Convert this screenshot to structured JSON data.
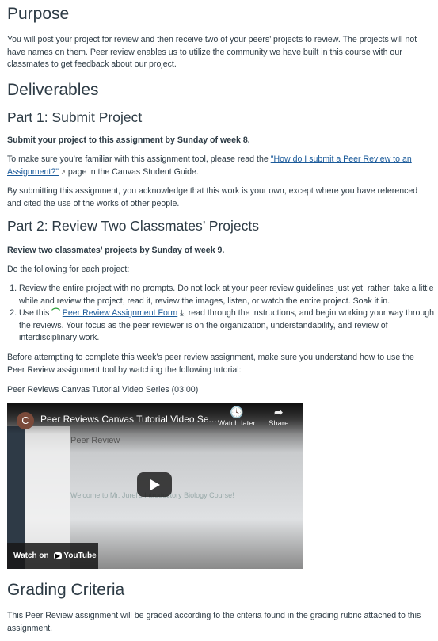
{
  "purpose": {
    "heading": "Purpose",
    "text": "You will post your project for review and then receive two of your peers’ projects to review. The projects will not have names on them. Peer review enables us to utilize the community we have built in this course with our classmates to get feedback about our project."
  },
  "deliverables": {
    "heading": "Deliverables"
  },
  "part1": {
    "heading": "Part 1: Submit Project",
    "bold": "Submit your project to this assignment by Sunday of week 8.",
    "p1_before": "To make sure you’re familiar with this assignment tool, please read the ",
    "p1_link": "\"How do I submit a Peer Review to an Assignment?\"",
    "p1_after": " page in the Canvas Student Guide.",
    "p2": "By submitting this assignment, you acknowledge that this work is your own, except where you have referenced and cited the use of the works of other people."
  },
  "part2": {
    "heading": "Part 2: Review Two Classmates’ Projects",
    "bold": "Review two classmates’ projects by Sunday of week 9.",
    "intro": "Do the following for each project:",
    "item1": "Review the entire project with no prompts. Do not look at your peer review guidelines just yet; rather, take a little while and review the project, read it, review the images, listen, or watch the entire project. Soak it in.",
    "item2_before": "Use this ",
    "item2_link": "Peer Review Assignment Form",
    "item2_after": ", read through the instructions, and begin working your way through the reviews. Your focus as the peer reviewer is on the organization, understandability, and review of interdisciplinary work.",
    "before_video": "Before attempting to complete this week’s peer review assignment, make sure you understand how to use the Peer Review assignment tool by watching the following tutorial:",
    "video_label": "Peer Reviews Canvas Tutorial Video Series (03:00)"
  },
  "video": {
    "channel_initial": "C",
    "title": "Peer Reviews Canvas Tutorial Video Se...",
    "watch_later": "Watch later",
    "share": "Share",
    "watch_on": "Watch on",
    "youtube": "YouTube",
    "frame_heading": "Peer Review",
    "frame_banner": "Welcome to Mr. Jurel's Introductory Biology Course!"
  },
  "grading": {
    "heading": "Grading Criteria",
    "text": "This Peer Review assignment will be graded according to the criteria found in the grading rubric attached to this assignment."
  }
}
